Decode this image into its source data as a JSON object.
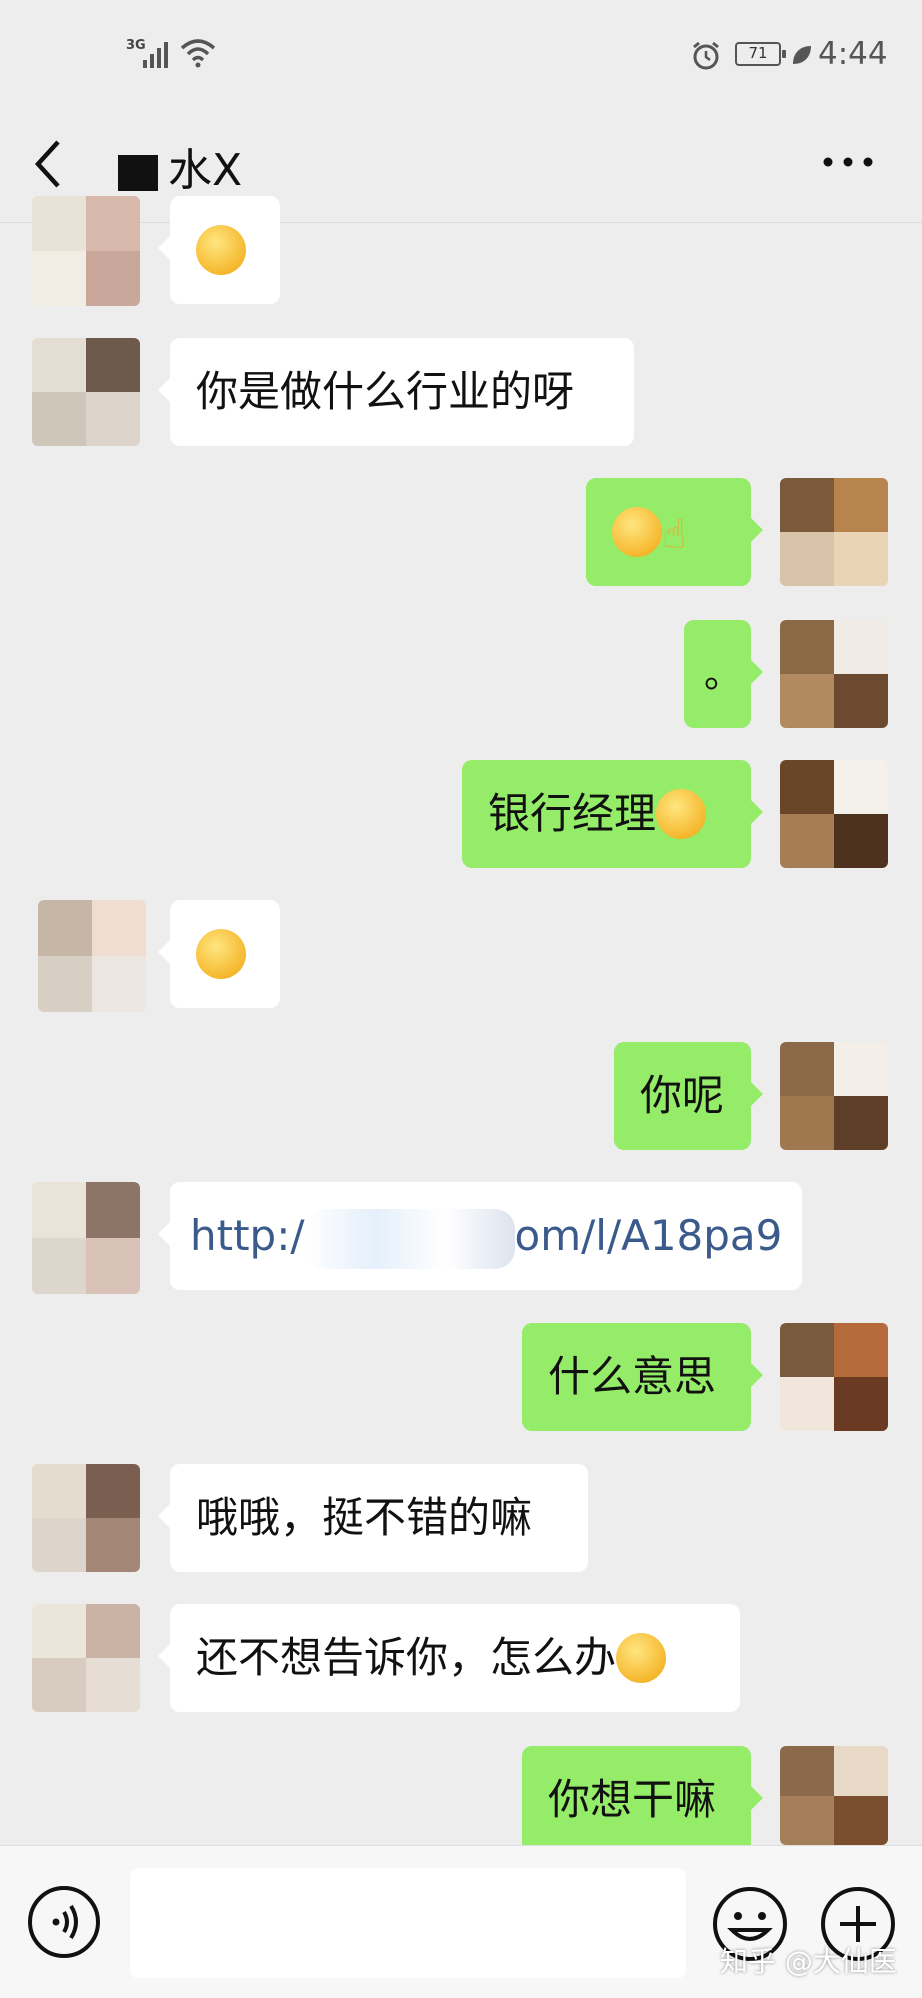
{
  "status_bar": {
    "network": "3G",
    "battery": "71",
    "time": "4:44"
  },
  "header": {
    "title": "水X"
  },
  "messages": [
    {
      "side": "in",
      "text": "",
      "emoji": "sweat-smile-emoji"
    },
    {
      "side": "in",
      "text": "你是做什么行业的呀"
    },
    {
      "side": "out",
      "text": "",
      "emoji": "pleading-emoji thumbs-up-emoji"
    },
    {
      "side": "out",
      "text": "。"
    },
    {
      "side": "out",
      "text": "银行经理",
      "emoji": "pleading-emoji"
    },
    {
      "side": "in",
      "text": "",
      "emoji": "smile-emoji"
    },
    {
      "side": "out",
      "text": "你呢"
    },
    {
      "side": "in",
      "text_prefix": "http:/",
      "text": "om/l/A18pa9"
    },
    {
      "side": "out",
      "text": "什么意思"
    },
    {
      "side": "in",
      "text": "哦哦，挺不错的嘛"
    },
    {
      "side": "in",
      "text": "还不想告诉你，怎么办",
      "emoji": "thinking-emoji"
    },
    {
      "side": "out",
      "text": "你想干嘛"
    }
  ],
  "watermark": "知乎 @大仙医",
  "colors": {
    "background": "#ededed",
    "incoming_bubble": "#ffffff",
    "outgoing_bubble": "#95ec69"
  }
}
